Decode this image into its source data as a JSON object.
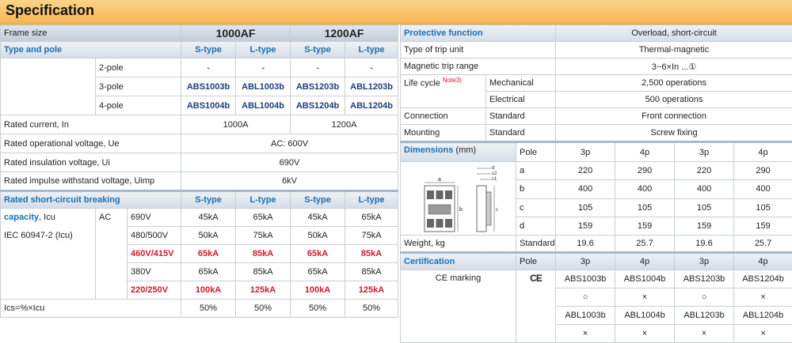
{
  "title": "Specification",
  "left": {
    "frame_size_label": "Frame size",
    "frames": [
      "1000AF",
      "1200AF"
    ],
    "type_pole_label": "Type and pole",
    "types": [
      "S-type",
      "L-type",
      "S-type",
      "L-type"
    ],
    "poles": [
      {
        "label": "2-pole",
        "values": [
          "-",
          "-",
          "-",
          "-"
        ]
      },
      {
        "label": "3-pole",
        "values": [
          "ABS1003b",
          "ABL1003b",
          "ABS1203b",
          "ABL1203b"
        ]
      },
      {
        "label": "4-pole",
        "values": [
          "ABS1004b",
          "ABL1004b",
          "ABS1204b",
          "ABL1204b"
        ]
      }
    ],
    "rated_current_label": "Rated current, In",
    "rated_current": [
      "1000A",
      "1200A"
    ],
    "op_voltage_label": "Rated operational voltage, Ue",
    "op_voltage": "AC: 600V",
    "ins_voltage_label": "Rated insulation voltage, Ui",
    "ins_voltage": "690V",
    "imp_voltage_label": "Rated impulse withstand voltage, Uimp",
    "imp_voltage": "6kV",
    "breaking_label": "Rated short-circuit breaking",
    "capacity_label": "capacity",
    "capacity_unit": ", Icu",
    "iec_label": "IEC 60947-2 (Icu)",
    "ac_label": "AC",
    "breaking_types": [
      "S-type",
      "L-type",
      "S-type",
      "L-type"
    ],
    "breaking_rows": [
      {
        "voltage": "690V",
        "values": [
          "45kA",
          "65kA",
          "45kA",
          "65kA"
        ]
      },
      {
        "voltage": "480/500V",
        "values": [
          "50kA",
          "75kA",
          "50kA",
          "75kA"
        ]
      },
      {
        "voltage": "460V/415V",
        "values": [
          "65kA",
          "85kA",
          "65kA",
          "85kA"
        ]
      },
      {
        "voltage": "380V",
        "values": [
          "65kA",
          "85kA",
          "65kA",
          "85kA"
        ]
      },
      {
        "voltage": "220/250V",
        "values": [
          "100kA",
          "125kA",
          "100kA",
          "125kA"
        ]
      }
    ],
    "ics_label": "Ics=%×Icu",
    "ics_values": [
      "50%",
      "50%",
      "50%",
      "50%"
    ]
  },
  "right": {
    "protective_label": "Protective function",
    "protective_value": "Overload, short-circuit",
    "trip_unit_label": "Type of trip unit",
    "trip_unit_value": "Thermal-magnetic",
    "mag_trip_label": "Magnetic trip range",
    "mag_trip_value": "3~6×In ...①",
    "life_cycle_label": "Life cycle",
    "life_cycle_note": "Note3)",
    "mechanical_label": "Mechanical",
    "mechanical_value": "2,500 operations",
    "electrical_label": "Electrical",
    "electrical_value": "500 operations",
    "connection_label": "Connection",
    "connection_std": "Standard",
    "connection_value": "Front connection",
    "mounting_label": "Mounting",
    "mounting_std": "Standard",
    "mounting_value": "Screw fixing",
    "dimensions_label": "Dimensions",
    "dimensions_unit": " (mm)",
    "pole_label": "Pole",
    "dim_poles": [
      "3p",
      "4p",
      "3p",
      "4p"
    ],
    "dim_rows": [
      {
        "label": "a",
        "values": [
          "220",
          "290",
          "220",
          "290"
        ]
      },
      {
        "label": "b",
        "values": [
          "400",
          "400",
          "400",
          "400"
        ]
      },
      {
        "label": "c",
        "values": [
          "105",
          "105",
          "105",
          "105"
        ]
      },
      {
        "label": "d",
        "values": [
          "159",
          "159",
          "159",
          "159"
        ]
      }
    ],
    "diagram_labels": {
      "a": "a",
      "b": "b",
      "c": "c",
      "d": "d",
      "c1": "c1",
      "c2": "c2"
    },
    "weight_label": "Weight, kg",
    "weight_std": "Standard",
    "weight_values": [
      "19.6",
      "25.7",
      "19.6",
      "25.7"
    ],
    "certification_label": "Certification",
    "cert_pole_label": "Pole",
    "cert_poles": [
      "3p",
      "4p",
      "3p",
      "4p"
    ],
    "ce_label": "CE marking",
    "ce_symbol": "CE",
    "cert_row1": [
      "ABS1003b",
      "ABS1004b",
      "ABS1203b",
      "ABS1204b"
    ],
    "cert_row2": [
      "○",
      "×",
      "○",
      "×"
    ],
    "cert_row3": [
      "ABL1003b",
      "ABL1004b",
      "ABL1203b",
      "ABL1204b"
    ],
    "cert_row4": [
      "×",
      "×",
      "×",
      "×"
    ]
  }
}
